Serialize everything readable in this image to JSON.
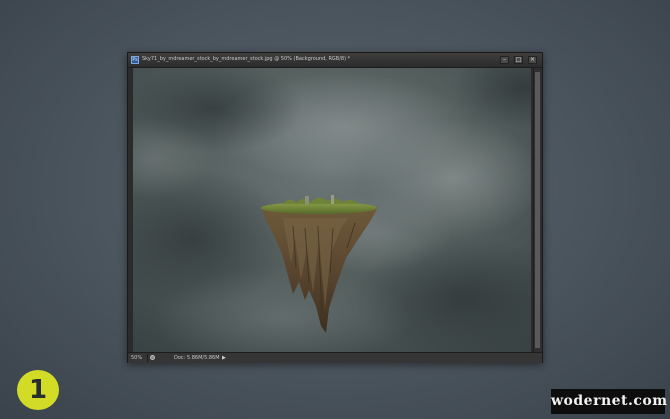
{
  "window": {
    "app_icon_letter": "Ps",
    "title": "Sky71_by_mdreamer_stock_by_mdreamer_stock.jpg @ 50% (Background, RGB/8) *",
    "controls": [
      "–",
      "□",
      "×"
    ]
  },
  "status_bar": {
    "zoom": "50%",
    "doc_size": "Doc: 5.86M/5.86M",
    "arrow": "▶"
  },
  "overlay": {
    "step_number": "1",
    "watermark": "wodernet.com"
  },
  "colors": {
    "badge": "#d2dc26",
    "window_chrome": "#2b2b2b",
    "background": "#4a545d"
  }
}
